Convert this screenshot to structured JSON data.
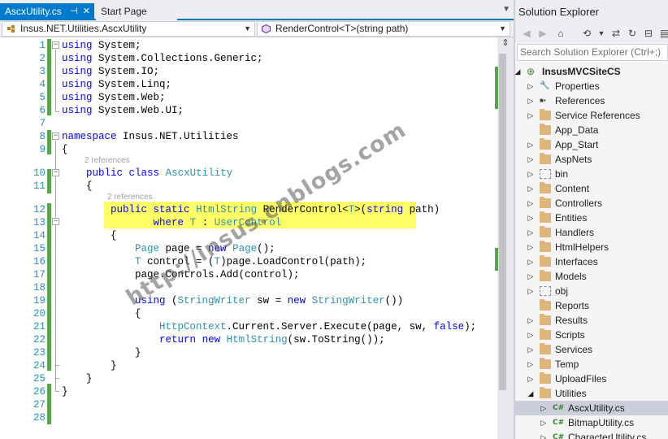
{
  "editor": {
    "tabs": [
      {
        "label": "AscxUtility.cs",
        "pin": "⊣",
        "close": "✕"
      },
      {
        "label": "Start Page"
      }
    ],
    "nav_left": "Insus.NET.Utilities.AscxUtility",
    "nav_right": "RenderControl<T>(string path)",
    "line_numbers": [
      "1",
      "2",
      "3",
      "4",
      "5",
      "6",
      "7",
      "8",
      "9",
      "10",
      "11",
      "12",
      "13",
      "14",
      "15",
      "16",
      "17",
      "18",
      "19",
      "20",
      "21",
      "22",
      "23",
      "24",
      "25",
      "26",
      "27",
      "28"
    ],
    "codelens_class": "2 references",
    "codelens_method": "2 references",
    "watermark": "http://insus.cnblogs.com",
    "code": {
      "l1": [
        {
          "t": "using",
          "c": "kw"
        },
        {
          "t": " System;"
        }
      ],
      "l2": [
        {
          "t": "using",
          "c": "kw"
        },
        {
          "t": " System.Collections.Generic;"
        }
      ],
      "l3": [
        {
          "t": "using",
          "c": "kw"
        },
        {
          "t": " System.IO;"
        }
      ],
      "l4": [
        {
          "t": "using",
          "c": "kw"
        },
        {
          "t": " System.Linq;"
        }
      ],
      "l5": [
        {
          "t": "using",
          "c": "kw"
        },
        {
          "t": " System.Web;"
        }
      ],
      "l6": [
        {
          "t": "using",
          "c": "kw"
        },
        {
          "t": " System.Web.UI;"
        }
      ],
      "l8": [
        {
          "t": "namespace",
          "c": "kw"
        },
        {
          "t": " Insus.NET.Utilities"
        }
      ],
      "l9": [
        {
          "t": "{"
        }
      ],
      "l10": [
        {
          "t": "    "
        },
        {
          "t": "public",
          "c": "kw"
        },
        {
          "t": " "
        },
        {
          "t": "class",
          "c": "kw"
        },
        {
          "t": " "
        },
        {
          "t": "AscxUtility",
          "c": "ty"
        }
      ],
      "l11": [
        {
          "t": "    {"
        }
      ],
      "l12": [
        {
          "t": "        "
        },
        {
          "t": "public",
          "c": "kw"
        },
        {
          "t": " "
        },
        {
          "t": "static",
          "c": "kw"
        },
        {
          "t": " "
        },
        {
          "t": "HtmlString",
          "c": "ty"
        },
        {
          "t": " RenderControl<"
        },
        {
          "t": "T",
          "c": "ty"
        },
        {
          "t": ">("
        },
        {
          "t": "string",
          "c": "kw"
        },
        {
          "t": " path)"
        }
      ],
      "l13": [
        {
          "t": "               "
        },
        {
          "t": "where",
          "c": "kw"
        },
        {
          "t": " "
        },
        {
          "t": "T",
          "c": "ty"
        },
        {
          "t": " : "
        },
        {
          "t": "UserControl",
          "c": "ty"
        }
      ],
      "l14": [
        {
          "t": "        {"
        }
      ],
      "l15": [
        {
          "t": "            "
        },
        {
          "t": "Page",
          "c": "ty"
        },
        {
          "t": " page = "
        },
        {
          "t": "new",
          "c": "kw"
        },
        {
          "t": " "
        },
        {
          "t": "Page",
          "c": "ty"
        },
        {
          "t": "();"
        }
      ],
      "l16": [
        {
          "t": "            "
        },
        {
          "t": "T",
          "c": "ty"
        },
        {
          "t": " control = ("
        },
        {
          "t": "T",
          "c": "ty"
        },
        {
          "t": ")page.LoadControl(path);"
        }
      ],
      "l17": [
        {
          "t": "            page.Controls.Add(control);"
        }
      ],
      "l19": [
        {
          "t": "            "
        },
        {
          "t": "using",
          "c": "kw"
        },
        {
          "t": " ("
        },
        {
          "t": "StringWriter",
          "c": "ty"
        },
        {
          "t": " sw = "
        },
        {
          "t": "new",
          "c": "kw"
        },
        {
          "t": " "
        },
        {
          "t": "StringWriter",
          "c": "ty"
        },
        {
          "t": "())"
        }
      ],
      "l20": [
        {
          "t": "            {"
        }
      ],
      "l21": [
        {
          "t": "                "
        },
        {
          "t": "HttpContext",
          "c": "ty"
        },
        {
          "t": ".Current.Server.Execute(page, sw, "
        },
        {
          "t": "false",
          "c": "kw"
        },
        {
          "t": ");"
        }
      ],
      "l22": [
        {
          "t": "                "
        },
        {
          "t": "return",
          "c": "kw"
        },
        {
          "t": " "
        },
        {
          "t": "new",
          "c": "kw"
        },
        {
          "t": " "
        },
        {
          "t": "HtmlString",
          "c": "ty"
        },
        {
          "t": "(sw.ToString());"
        }
      ],
      "l23": [
        {
          "t": "            }"
        }
      ],
      "l24": [
        {
          "t": "        }"
        }
      ],
      "l25": [
        {
          "t": "    }"
        }
      ],
      "l26": [
        {
          "t": "}"
        }
      ]
    }
  },
  "solution_explorer": {
    "title": "Solution Explorer",
    "search_placeholder": "Search Solution Explorer (Ctrl+;)",
    "toolbar_icons": [
      "back-icon",
      "forward-icon",
      "home-icon",
      "history-icon",
      "sync-icon",
      "refresh-icon",
      "collapse-icon",
      "properties-icon"
    ],
    "items": [
      {
        "label": "InsusMVCSiteCS",
        "icon": "web-project-icon",
        "expander": "expanded",
        "bold": true
      },
      {
        "label": "Properties",
        "icon": "wrench-icon",
        "expander": "collapsed"
      },
      {
        "label": "References",
        "icon": "references-icon",
        "expander": "collapsed"
      },
      {
        "label": "Service References",
        "icon": "folder-icon",
        "expander": "collapsed"
      },
      {
        "label": "App_Data",
        "icon": "folder-icon",
        "expander": "none"
      },
      {
        "label": "App_Start",
        "icon": "folder-icon",
        "expander": "collapsed"
      },
      {
        "label": "AspNets",
        "icon": "folder-icon",
        "expander": "collapsed"
      },
      {
        "label": "bin",
        "icon": "hidden-folder-icon",
        "expander": "collapsed"
      },
      {
        "label": "Content",
        "icon": "folder-icon",
        "expander": "collapsed"
      },
      {
        "label": "Controllers",
        "icon": "folder-icon",
        "expander": "collapsed"
      },
      {
        "label": "Entities",
        "icon": "folder-icon",
        "expander": "collapsed"
      },
      {
        "label": "Handlers",
        "icon": "folder-icon",
        "expander": "collapsed"
      },
      {
        "label": "HtmlHelpers",
        "icon": "folder-icon",
        "expander": "collapsed"
      },
      {
        "label": "Interfaces",
        "icon": "folder-icon",
        "expander": "collapsed"
      },
      {
        "label": "Models",
        "icon": "folder-icon",
        "expander": "collapsed"
      },
      {
        "label": "obj",
        "icon": "hidden-folder-icon",
        "expander": "collapsed"
      },
      {
        "label": "Reports",
        "icon": "folder-icon",
        "expander": "none"
      },
      {
        "label": "Results",
        "icon": "folder-icon",
        "expander": "collapsed"
      },
      {
        "label": "Scripts",
        "icon": "folder-icon",
        "expander": "collapsed"
      },
      {
        "label": "Services",
        "icon": "folder-icon",
        "expander": "collapsed"
      },
      {
        "label": "Temp",
        "icon": "folder-icon",
        "expander": "collapsed"
      },
      {
        "label": "UploadFiles",
        "icon": "folder-icon",
        "expander": "collapsed"
      },
      {
        "label": "Utilities",
        "icon": "folder-icon",
        "expander": "expanded"
      },
      {
        "label": "AscxUtility.cs",
        "icon": "csharp-file-icon",
        "expander": "collapsed",
        "selected": true
      },
      {
        "label": "BitmapUtility.cs",
        "icon": "csharp-file-icon",
        "expander": "collapsed"
      },
      {
        "label": "CharacterUtility.cs",
        "icon": "csharp-file-icon",
        "expander": "collapsed"
      }
    ]
  },
  "colors": {
    "accent": "#007acc",
    "keyword": "#0000ff",
    "type": "#2b91af",
    "highlight": "#ffff66",
    "change_bar": "#57a64a"
  }
}
